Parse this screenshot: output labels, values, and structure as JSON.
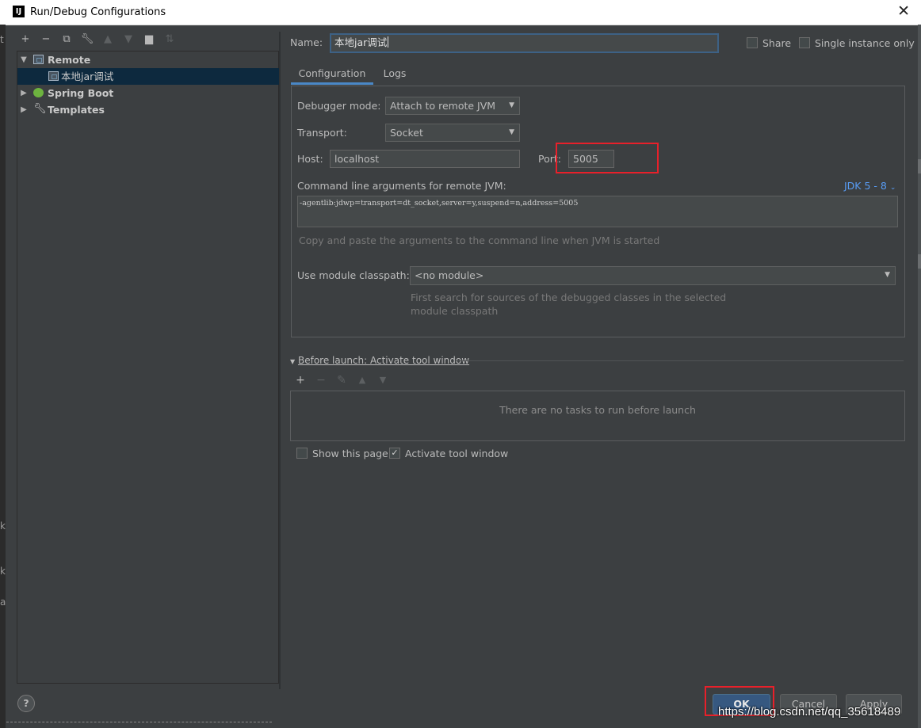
{
  "window": {
    "title": "Run/Debug Configurations",
    "app_icon_letter": "IJ"
  },
  "tree": {
    "items": [
      {
        "label": "Remote",
        "expanded": true
      },
      {
        "label": "本地jar调试",
        "selected": true
      },
      {
        "label": "Spring Boot",
        "expanded": false
      },
      {
        "label": "Templates",
        "expanded": false
      }
    ]
  },
  "form": {
    "name_label": "Name:",
    "name_value": "本地jar调试",
    "share_label": "Share",
    "single_instance_label": "Single instance only",
    "tabs": [
      {
        "label": "Configuration",
        "active": true
      },
      {
        "label": "Logs",
        "active": false
      }
    ],
    "debugger_mode_label": "Debugger mode:",
    "debugger_mode_value": "Attach to remote JVM",
    "transport_label": "Transport:",
    "transport_value": "Socket",
    "host_label": "Host:",
    "host_value": "localhost",
    "port_label": "Port:",
    "port_value": "5005",
    "cmdline_label": "Command line arguments for remote JVM:",
    "jdk_selector": "JDK 5 - 8",
    "cmdline_value": "-agentlib:jdwp=transport=dt_socket,server=y,suspend=n,address=5005",
    "cmdline_hint": "Copy and paste the arguments to the command line when JVM is started",
    "module_label": "Use module classpath:",
    "module_value": "<no module>",
    "module_hint_line1": "First search for sources of the debugged classes in the selected",
    "module_hint_line2": "module classpath"
  },
  "before_launch": {
    "title": "Before launch: Activate tool window",
    "empty_message": "There are no tasks to run before launch",
    "show_page_label": "Show this page",
    "show_page_checked": false,
    "activate_tool_label": "Activate tool window",
    "activate_tool_checked": true
  },
  "buttons": {
    "help": "?",
    "ok": "OK",
    "cancel": "Cancel",
    "apply": "Apply"
  },
  "left_edge_glyphs": [
    "t",
    "k",
    "k",
    "a"
  ],
  "watermark": "https://blog.csdn.net/qq_35618489",
  "colors": {
    "background": "#3c3f41",
    "selection": "#0d293e",
    "accent_link": "#589df6",
    "highlight_box": "#e8202a",
    "primary_button": "#365880"
  }
}
